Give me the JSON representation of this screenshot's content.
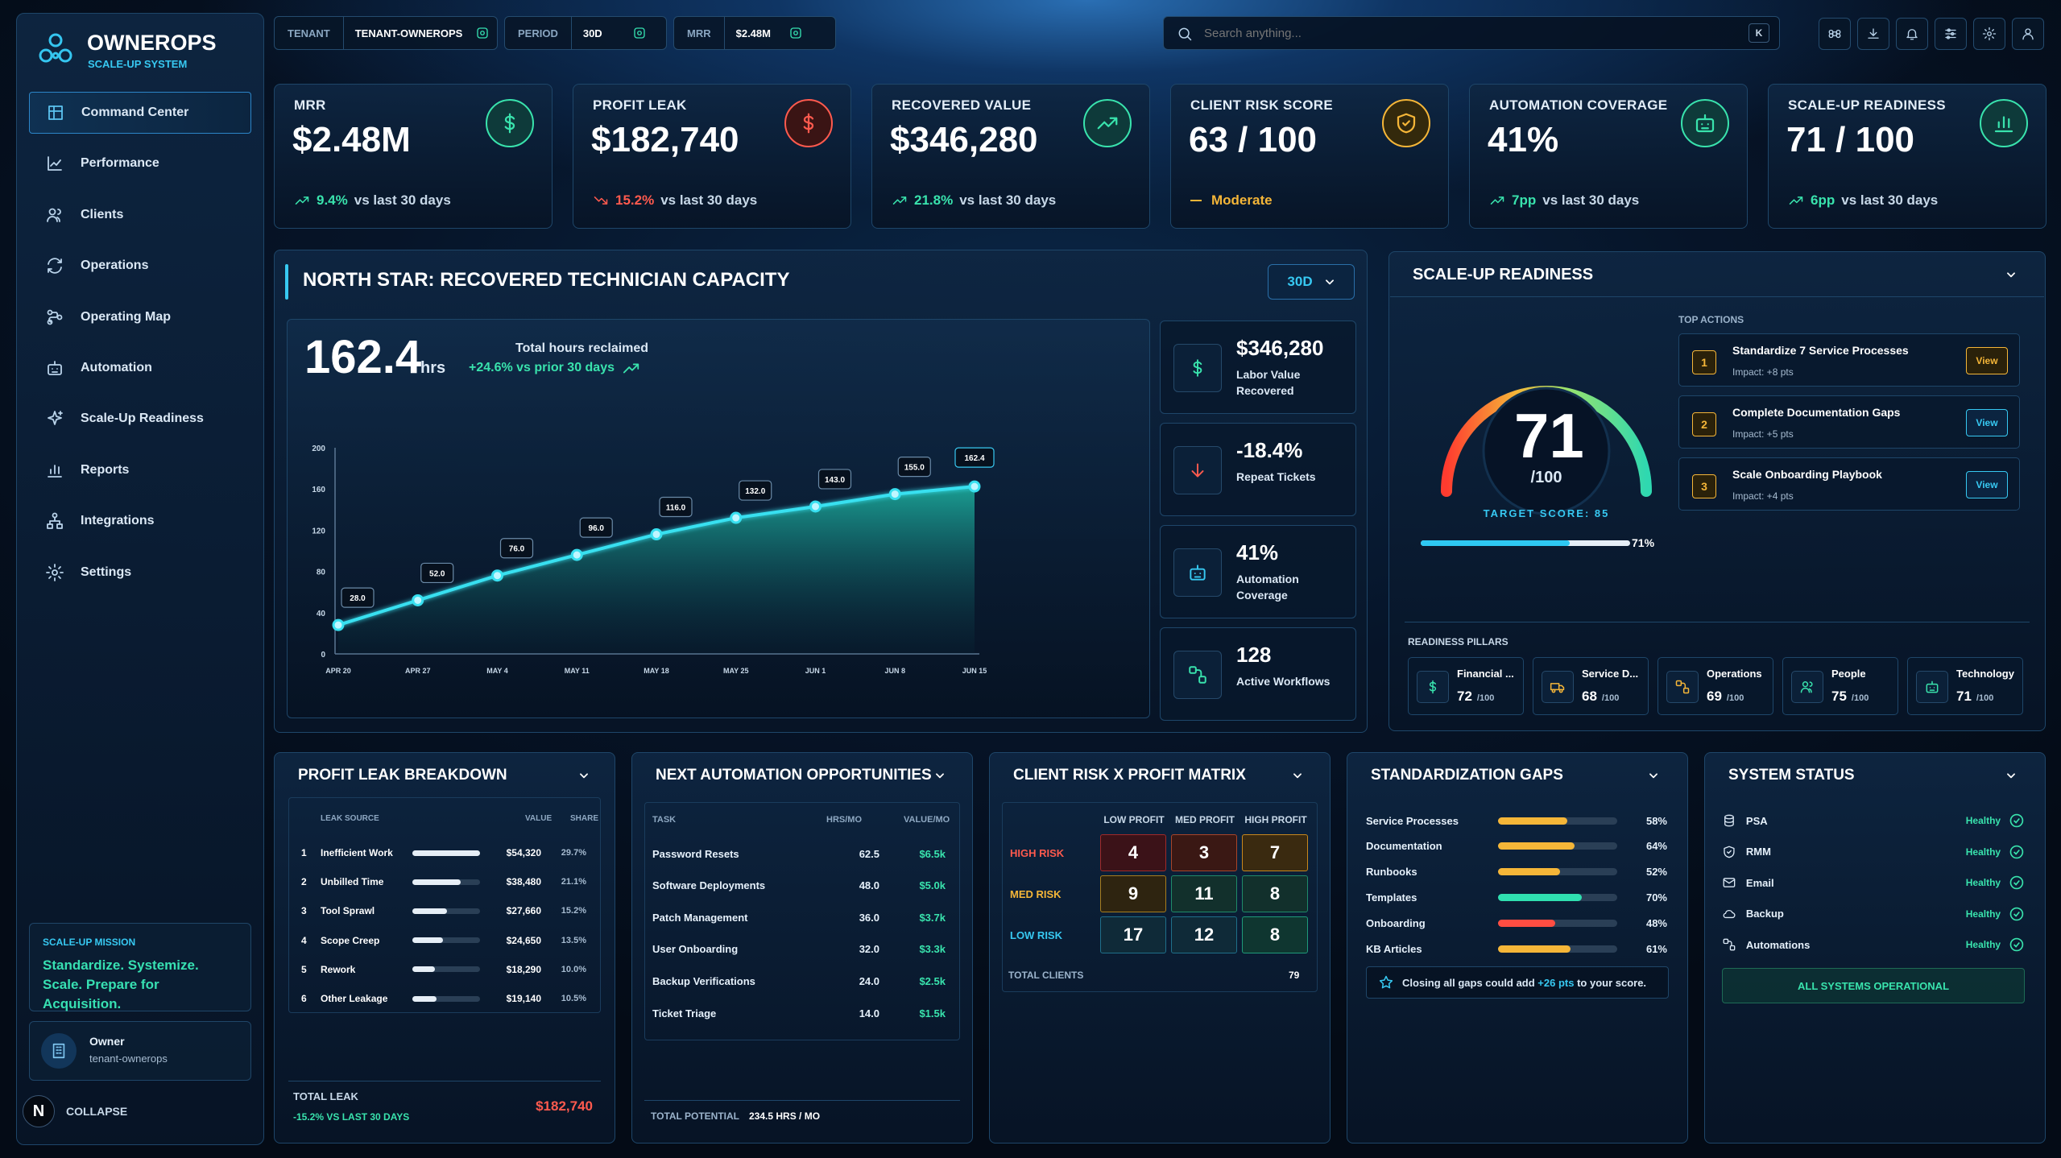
{
  "app": {
    "name": "OWNEROPS",
    "subtitle": "SCALE-UP SYSTEM"
  },
  "sidebar": {
    "items": [
      {
        "label": "Command Center",
        "icon": "grid-icon",
        "active": true
      },
      {
        "label": "Performance",
        "icon": "chart-line-icon"
      },
      {
        "label": "Clients",
        "icon": "users-icon"
      },
      {
        "label": "Operations",
        "icon": "refresh-icon"
      },
      {
        "label": "Operating Map",
        "icon": "map-icon"
      },
      {
        "label": "Automation",
        "icon": "robot-icon"
      },
      {
        "label": "Scale-Up Readiness",
        "icon": "sparkle-icon"
      },
      {
        "label": "Reports",
        "icon": "bar-chart-icon"
      },
      {
        "label": "Integrations",
        "icon": "network-icon"
      },
      {
        "label": "Settings",
        "icon": "gear-icon"
      }
    ],
    "mission": {
      "label": "SCALE-UP MISSION",
      "text": "Standardize. Systemize. Scale. Prepare for Acquisition."
    },
    "user": {
      "name": "Owner",
      "tenant": "tenant-ownerops"
    },
    "collapse": "COLLAPSE",
    "avatar_letter": "N"
  },
  "topbar": {
    "tenant_label": "TENANT",
    "tenant_value": "TENANT-OWNEROPS",
    "period_label": "PERIOD",
    "period_value": "30D",
    "mrr_label": "MRR",
    "mrr_value": "$2.48M",
    "search_placeholder": "Search anything...",
    "search_key": "K"
  },
  "kpis": [
    {
      "label": "MRR",
      "value": "$2.48M",
      "delta": "9.4%",
      "suffix": "vs last 30 days",
      "trend": "up",
      "icon": "dollar-icon"
    },
    {
      "label": "PROFIT LEAK",
      "value": "$182,740",
      "delta": "15.2%",
      "suffix": "vs last 30 days",
      "trend": "down",
      "icon": "dollar-icon"
    },
    {
      "label": "RECOVERED VALUE",
      "value": "$346,280",
      "delta": "21.8%",
      "suffix": "vs last 30 days",
      "trend": "up",
      "icon": "trend-up-icon"
    },
    {
      "label": "CLIENT RISK SCORE",
      "value": "63 / 100",
      "delta": "Moderate",
      "suffix": "",
      "trend": "flat",
      "icon": "shield-icon"
    },
    {
      "label": "AUTOMATION COVERAGE",
      "value": "41%",
      "delta": "7pp",
      "suffix": "vs last 30 days",
      "trend": "up",
      "icon": "robot-icon"
    },
    {
      "label": "SCALE-UP READINESS",
      "value": "71 / 100",
      "delta": "6pp",
      "suffix": "vs last 30 days",
      "trend": "up",
      "icon": "bar-chart-icon"
    }
  ],
  "north_star": {
    "title": "NORTH STAR: RECOVERED TECHNICIAN CAPACITY",
    "period": "30D",
    "value": "162.4",
    "unit": "hrs",
    "caption": "Total hours reclaimed",
    "delta": "+24.6% vs prior 30 days",
    "side": [
      {
        "value": "$346,280",
        "label": "Labor Value Recovered",
        "icon": "dollar-icon"
      },
      {
        "value": "-18.4%",
        "label": "Repeat Tickets",
        "icon": "arrow-down-icon"
      },
      {
        "value": "41%",
        "label": "Automation Coverage",
        "icon": "robot-icon"
      },
      {
        "value": "128",
        "label": "Active Workflows",
        "icon": "workflow-icon"
      }
    ]
  },
  "chart_data": {
    "type": "area",
    "x": [
      "APR 20",
      "APR 27",
      "MAY 4",
      "MAY 11",
      "MAY 18",
      "MAY 25",
      "JUN 1",
      "JUN 8",
      "JUN 15"
    ],
    "values": [
      28.0,
      52.0,
      76.0,
      96.0,
      116.0,
      132.0,
      143.0,
      155.0,
      162.4
    ],
    "labels": [
      "28.0",
      "52.0",
      "76.0",
      "96.0",
      "116.0",
      "132.0",
      "143.0",
      "155.0",
      "162.4"
    ],
    "yticks": [
      "0",
      "40",
      "80",
      "120",
      "160",
      "200"
    ],
    "ylim": [
      0,
      200
    ],
    "grid": false
  },
  "readiness": {
    "title": "SCALE-UP READINESS",
    "score": "71",
    "of": "/100",
    "target": "TARGET SCORE: 85",
    "progress_label": "71%",
    "progress": 0.71,
    "actions_label": "TOP ACTIONS",
    "actions": [
      {
        "n": "1",
        "title": "Standardize 7 Service Processes",
        "impact": "Impact: +8 pts",
        "btn": "View"
      },
      {
        "n": "2",
        "title": "Complete Documentation Gaps",
        "impact": "Impact: +5 pts",
        "btn": "View"
      },
      {
        "n": "3",
        "title": "Scale Onboarding Playbook",
        "impact": "Impact: +4 pts",
        "btn": "View"
      }
    ],
    "pillars_label": "READINESS PILLARS",
    "pillars": [
      {
        "name": "Financial ...",
        "score": "72",
        "of": "/100",
        "icon": "dollar-icon"
      },
      {
        "name": "Service D...",
        "score": "68",
        "of": "/100",
        "icon": "truck-icon"
      },
      {
        "name": "Operations",
        "score": "69",
        "of": "/100",
        "icon": "workflow-icon"
      },
      {
        "name": "People",
        "score": "75",
        "of": "/100",
        "icon": "users-icon"
      },
      {
        "name": "Technology",
        "score": "71",
        "of": "/100",
        "icon": "robot-icon"
      }
    ]
  },
  "profit_leak": {
    "title": "PROFIT LEAK BREAKDOWN",
    "headers": [
      "LEAK SOURCE",
      "VALUE",
      "SHARE"
    ],
    "rows": [
      {
        "n": "1",
        "name": "Inefficient Work",
        "value": "$54,320",
        "share": "29.7%",
        "pct": 0.297
      },
      {
        "n": "2",
        "name": "Unbilled Time",
        "value": "$38,480",
        "share": "21.1%",
        "pct": 0.211
      },
      {
        "n": "3",
        "name": "Tool Sprawl",
        "value": "$27,660",
        "share": "15.2%",
        "pct": 0.152
      },
      {
        "n": "4",
        "name": "Scope Creep",
        "value": "$24,650",
        "share": "13.5%",
        "pct": 0.135
      },
      {
        "n": "5",
        "name": "Rework",
        "value": "$18,290",
        "share": "10.0%",
        "pct": 0.1
      },
      {
        "n": "6",
        "name": "Other Leakage",
        "value": "$19,140",
        "share": "10.5%",
        "pct": 0.105
      }
    ],
    "total_label": "TOTAL LEAK",
    "total_value": "$182,740",
    "total_delta": "-15.2% VS LAST 30 DAYS"
  },
  "automation": {
    "title": "NEXT AUTOMATION OPPORTUNITIES",
    "headers": [
      "TASK",
      "HRS/MO",
      "VALUE/MO"
    ],
    "rows": [
      {
        "task": "Password Resets",
        "hrs": "62.5",
        "value": "$6.5k"
      },
      {
        "task": "Software Deployments",
        "hrs": "48.0",
        "value": "$5.0k"
      },
      {
        "task": "Patch Management",
        "hrs": "36.0",
        "value": "$3.7k"
      },
      {
        "task": "User Onboarding",
        "hrs": "32.0",
        "value": "$3.3k"
      },
      {
        "task": "Backup Verifications",
        "hrs": "24.0",
        "value": "$2.5k"
      },
      {
        "task": "Ticket Triage",
        "hrs": "14.0",
        "value": "$1.5k"
      }
    ],
    "total_label": "TOTAL POTENTIAL",
    "total_value": "234.5 HRS / MO"
  },
  "matrix": {
    "title": "CLIENT RISK X PROFIT MATRIX",
    "cols": [
      "LOW PROFIT",
      "MED PROFIT",
      "HIGH PROFIT"
    ],
    "rows": [
      {
        "label": "HIGH RISK",
        "cells": [
          "4",
          "3",
          "7"
        ]
      },
      {
        "label": "MED RISK",
        "cells": [
          "9",
          "11",
          "8"
        ]
      },
      {
        "label": "LOW RISK",
        "cells": [
          "17",
          "12",
          "8"
        ]
      }
    ],
    "total_label": "TOTAL CLIENTS",
    "total_value": "79"
  },
  "gaps": {
    "title": "STANDARDIZATION GAPS",
    "rows": [
      {
        "name": "Service Processes",
        "pct": "58%",
        "v": 0.58,
        "color": "#f5b638"
      },
      {
        "name": "Documentation",
        "pct": "64%",
        "v": 0.64,
        "color": "#f5b638"
      },
      {
        "name": "Runbooks",
        "pct": "52%",
        "v": 0.52,
        "color": "#f5b638"
      },
      {
        "name": "Templates",
        "pct": "70%",
        "v": 0.7,
        "color": "#2fe0b0"
      },
      {
        "name": "Onboarding",
        "pct": "48%",
        "v": 0.48,
        "color": "#ff4d42"
      },
      {
        "name": "KB Articles",
        "pct": "61%",
        "v": 0.61,
        "color": "#f5b638"
      }
    ],
    "note_pre": "Closing all gaps could add ",
    "note_hl": "+26 pts",
    "note_post": " to your score."
  },
  "status": {
    "title": "SYSTEM STATUS",
    "rows": [
      {
        "name": "PSA",
        "state": "Healthy",
        "icon": "database-icon"
      },
      {
        "name": "RMM",
        "state": "Healthy",
        "icon": "shield-icon"
      },
      {
        "name": "Email",
        "state": "Healthy",
        "icon": "mail-icon"
      },
      {
        "name": "Backup",
        "state": "Healthy",
        "icon": "cloud-icon"
      },
      {
        "name": "Automations",
        "state": "Healthy",
        "icon": "workflow-icon"
      }
    ],
    "banner": "ALL SYSTEMS OPERATIONAL"
  }
}
